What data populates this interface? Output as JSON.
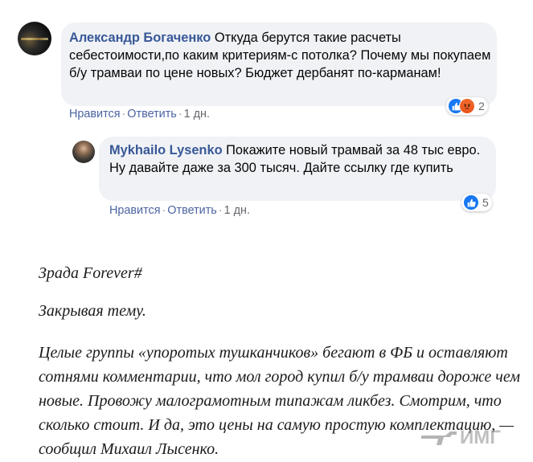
{
  "comments": [
    {
      "author": "Александр Богаченко",
      "text": "Откуда берутся такие расчеты себестоимости,по каким критериям-с потолка? Почему мы покупаем б/у трамваи по цене новых? Бюджет дербанят по-карманам!",
      "like_label": "Нравится",
      "reply_label": "Ответить",
      "time": "1 дн.",
      "reaction_count": "2",
      "reactions": [
        "like-icon",
        "angry-icon"
      ]
    },
    {
      "author": "Mykhailo Lysenko",
      "text": "Покажите новый трамвай за 48 тыс евро. Ну давайте даже за 300 тысяч. Дайте ссылку где купить",
      "like_label": "Нравится",
      "reply_label": "Ответить",
      "time": "1 дн.",
      "reaction_count": "5",
      "reactions": [
        "like-icon"
      ]
    }
  ],
  "article": {
    "tag": "Зрада Forever#",
    "heading": "Закрывая тему.",
    "body": "Целые группы «упоротых тушканчиков» бегают в ФБ и оставляют сотнями комментарии, что мол город купил б/у трамваи дороже чем новые. Провожу малограмотным типажам ликбез. Смотрим, что сколько стоит. И да, это цены на самую простую комплектацию, — сообщил Михаил Лысенко."
  },
  "watermark_text": "ИМГ",
  "colors": {
    "author": "#385898",
    "bubble": "#f0f2f5",
    "like": "#1877f2",
    "angry": "#e8541a"
  }
}
